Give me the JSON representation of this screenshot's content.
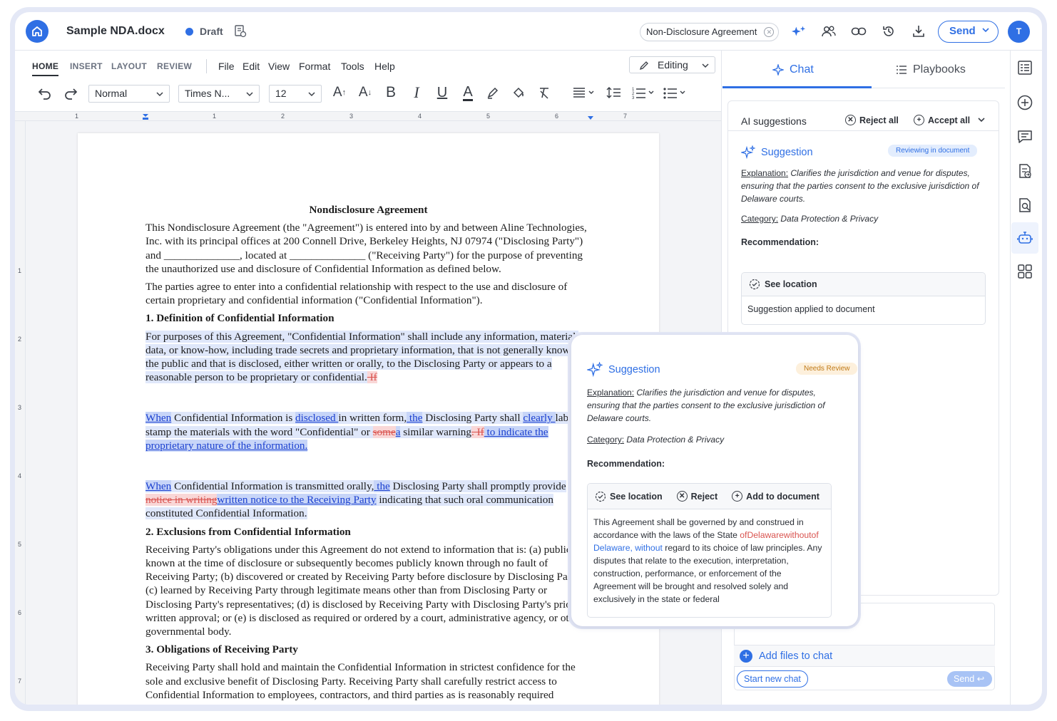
{
  "header": {
    "doc_title": "Sample NDA.docx",
    "status": "Draft",
    "doc_type": "Non-Disclosure Agreement",
    "send_label": "Send",
    "avatar_initial": "T",
    "accent": "#2f6fe4"
  },
  "ribbon": {
    "tabs": [
      "HOME",
      "INSERT",
      "LAYOUT",
      "REVIEW"
    ],
    "menus": [
      "File",
      "Edit",
      "View",
      "Format",
      "Tools",
      "Help"
    ],
    "mode": "Editing",
    "style": "Normal",
    "font": "Times N...",
    "size": "12"
  },
  "ruler": {
    "top_numbers": [
      "1",
      "1",
      "2",
      "3",
      "4",
      "5",
      "6",
      "7"
    ],
    "left_numbers": [
      "1",
      "2",
      "3",
      "4",
      "5",
      "6",
      "7"
    ]
  },
  "document": {
    "title": "Nondisclosure Agreement",
    "intro": "This Nondisclosure Agreement (the \"Agreement\") is entered into by and between Aline Technologies, Inc. with its principal offices at 200 Connell Drive, Berkeley Heights, NJ 07974 (\"Disclosing Party\") and ______________, located at ______________ (\"Receiving Party\") for the purpose of preventing the unauthorized use and disclosure of Confidential Information as defined below.",
    "para2": "The parties agree to enter into a confidential relationship with respect to the use and disclosure of certain proprietary and confidential information (\"Confidential Information\").",
    "h1": "1. Definition of Confidential Information",
    "def_text": "For purposes of this Agreement, \"Confidential Information\" shall include any information, material, data, or know-how, including trade secrets and proprietary information, that is not generally known to the public and that is disclosed, either written or orally, to the Disclosing Party or appears to a reasonable person to be proprietary or confidential.",
    "def_del": " If",
    "p3": {
      "ins1": "When",
      "t1": " Confidential Information is ",
      "ins2": "disclosed ",
      "t2": "in written form,",
      "ins3": " the",
      "t3": " Disclosing Party shall ",
      "ins4": "clearly ",
      "t4": "label or stamp the materials with the word \"Confidential\" or ",
      "del1": "some",
      "ins5": "a",
      "t5": " similar warning",
      "del2": ". If",
      "ins6": " to indicate the proprietary nature of the information."
    },
    "p4": {
      "ins1": "When",
      "t1": " Confidential Information is transmitted orally,",
      "ins2": " the",
      "t2": " Disclosing Party shall promptly provide ",
      "del1": "notice in writing",
      "ins3": "written notice to the Receiving Party",
      "t3": " indicating that such oral communication constituted Confidential Information."
    },
    "h2": "2. Exclusions from Confidential Information",
    "excl_text": "Receiving Party's obligations under this Agreement do not extend to information that is: (a) publicly known at the time of disclosure or subsequently becomes publicly known through no fault of Receiving Party; (b) discovered or created by Receiving Party before disclosure by Disclosing Party; (c) learned by Receiving Party through legitimate means other than from Disclosing Party or Disclosing Party's representatives; (d) is disclosed by Receiving Party with Disclosing Party's prior written approval; or (e) is disclosed as required or ordered by a court, administrative agency, or other governmental body.",
    "h3": "3. Obligations of Receiving Party",
    "oblig_text": "Receiving Party shall hold and maintain the Confidential Information in strictest confidence for the sole and exclusive benefit of Disclosing Party. Receiving Party shall carefully restrict access to Confidential Information to employees, contractors, and third parties as is reasonably required"
  },
  "panel": {
    "tabs": [
      "Chat",
      "Playbooks"
    ],
    "ai_title": "AI suggestions",
    "reject_all": "Reject all",
    "accept_all": "Accept all",
    "suggestion": {
      "title": "Suggestion",
      "badge": "Reviewing in document",
      "explanation_label": "Explanation:",
      "explanation": "Clarifies the jurisdiction and venue for disputes, ensuring that the parties consent to the exclusive jurisdiction of Delaware courts.",
      "category_label": "Category:",
      "category": "Data Protection & Privacy",
      "recommendation": "Recommendation:",
      "see_location": "See location",
      "applied": "Suggestion applied to document"
    },
    "add_files": "Add files to chat",
    "start_new_chat": "Start new chat",
    "send": "Send"
  },
  "popover": {
    "title": "Suggestion",
    "badge": "Needs Review",
    "explanation_label": "Explanation:",
    "explanation": "Clarifies the jurisdiction and venue for disputes, ensuring that the parties consent to the exclusive jurisdiction of Delaware courts.",
    "category_label": "Category:",
    "category": "Data Protection & Privacy",
    "recommendation": "Recommendation:",
    "see_location": "See location",
    "reject": "Reject",
    "add_to_document": "Add to document",
    "body_1": "This Agreement shall be governed by and construed in accordance with the laws of the State ",
    "body_del": "ofDelawarewithoutof",
    "body_ins": " Delaware, without",
    "body_2": " regard to its choice of law principles. Any disputes that relate to the execution, interpretation, construction, performance, or enforcement of the Agreement will be brought and resolved solely and exclusively in the state or federal"
  }
}
